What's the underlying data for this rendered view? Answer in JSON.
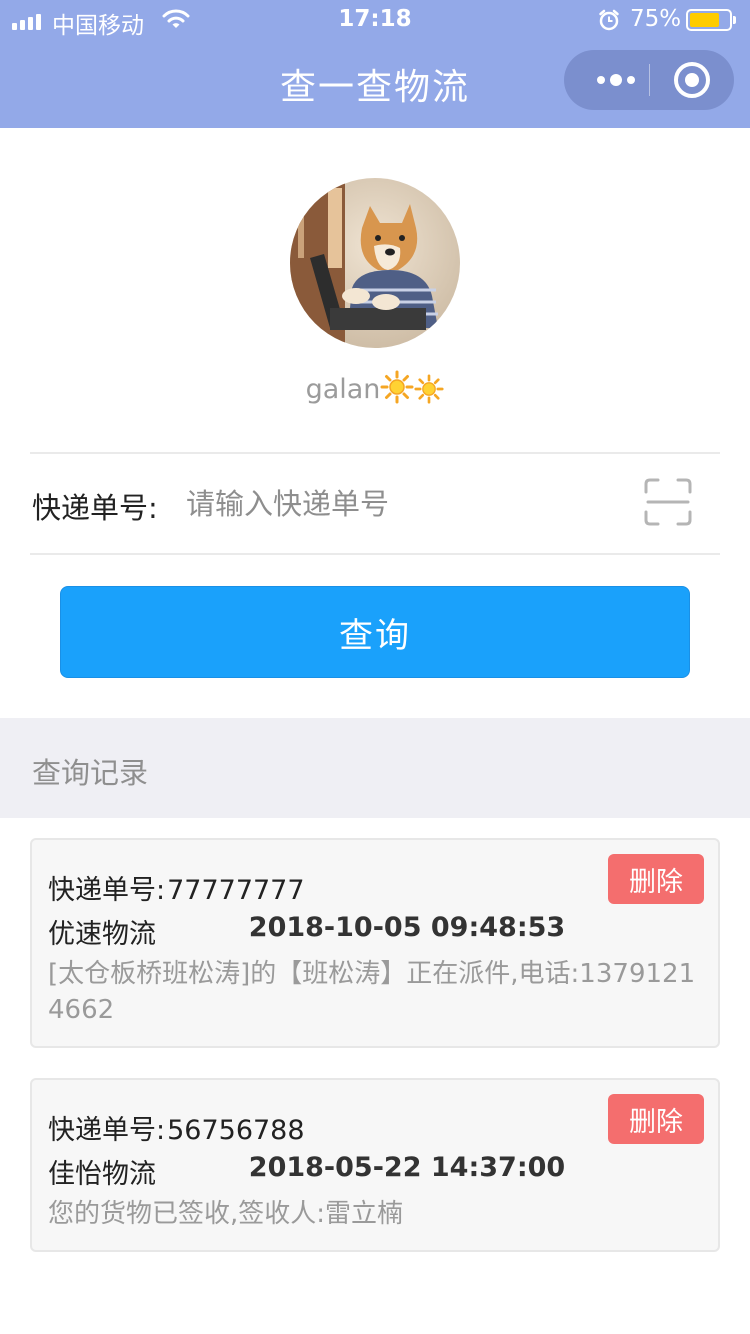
{
  "status": {
    "carrier": "中国移动",
    "time": "17:18",
    "battery": "75%",
    "battery_level": 0.75
  },
  "nav": {
    "title": "查一查物流"
  },
  "profile": {
    "username": "galan"
  },
  "search": {
    "label": "快递单号:",
    "placeholder": "请输入快递单号",
    "value": "",
    "button_label": "查询"
  },
  "history": {
    "title": "查询记录",
    "records": [
      {
        "number_label": "快递单号:",
        "number": "77777777",
        "delete_label": "删除",
        "company": "优速物流",
        "time": "2018-10-05 09:48:53",
        "info": "[太仓板桥班松涛]的【班松涛】正在派件,电话:13791214662"
      },
      {
        "number_label": "快递单号:",
        "number": "56756788",
        "delete_label": "删除",
        "company": "佳怡物流",
        "time": "2018-05-22 14:37:00",
        "info": "您的货物已签收,签收人:雷立楠"
      }
    ]
  },
  "colors": {
    "header": "#93a9e8",
    "primary_button": "#1aa1fb",
    "delete_button": "#f46e6e",
    "section_bg": "#efeff4"
  },
  "icons": {
    "signal": "signal-icon",
    "wifi": "wifi-icon",
    "alarm": "alarm-icon",
    "battery": "battery-icon",
    "more": "more-dots-icon",
    "close": "close-miniprogram-icon",
    "scan": "scan-icon",
    "sun": "sun-icon"
  }
}
